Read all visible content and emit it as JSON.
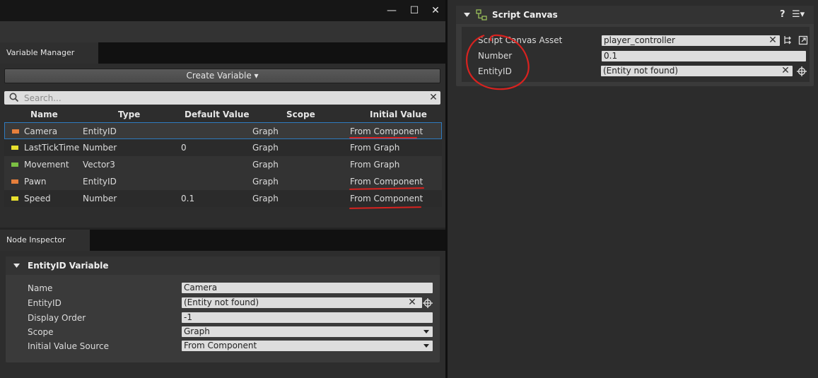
{
  "window_controls": {
    "minimize": "—",
    "maximize": "☐",
    "close": "✕"
  },
  "variable_manager": {
    "tab_label": "Variable Manager",
    "create_button": "Create Variable ▾",
    "search_placeholder": "Search...",
    "columns": [
      "Name",
      "Type",
      "Default Value",
      "Scope",
      "Initial Value"
    ],
    "rows": [
      {
        "name": "Camera",
        "type": "EntityID",
        "default": "",
        "scope": "Graph",
        "initial": "From Component",
        "color": "#e67f3c",
        "selected": true
      },
      {
        "name": "LastTickTime",
        "type": "Number",
        "default": "0",
        "scope": "Graph",
        "initial": "From Graph",
        "color": "#e8e02e"
      },
      {
        "name": "Movement",
        "type": "Vector3",
        "default": "",
        "scope": "Graph",
        "initial": "From Graph",
        "color": "#7bc043"
      },
      {
        "name": "Pawn",
        "type": "EntityID",
        "default": "",
        "scope": "Graph",
        "initial": "From Component",
        "color": "#e67f3c"
      },
      {
        "name": "Speed",
        "type": "Number",
        "default": "0.1",
        "scope": "Graph",
        "initial": "From Component",
        "color": "#e8e02e"
      }
    ]
  },
  "node_inspector": {
    "tab_label": "Node Inspector",
    "section_title": "EntityID Variable",
    "props": {
      "name_label": "Name",
      "name_value": "Camera",
      "entity_label": "EntityID",
      "entity_value": "(Entity not found)",
      "order_label": "Display Order",
      "order_value": "-1",
      "scope_label": "Scope",
      "scope_value": "Graph",
      "source_label": "Initial Value Source",
      "source_value": "From Component"
    }
  },
  "script_canvas": {
    "title": "Script Canvas",
    "help": "?",
    "menu": "☰▾",
    "asset_label": "Script Canvas Asset",
    "asset_value": "player_controller",
    "number_label": "Number",
    "number_value": "0.1",
    "entity_label": "EntityID",
    "entity_value": "(Entity not found)"
  },
  "colors": {
    "annotation_red": "#d8221f",
    "selection_blue": "#2e7bbf"
  }
}
